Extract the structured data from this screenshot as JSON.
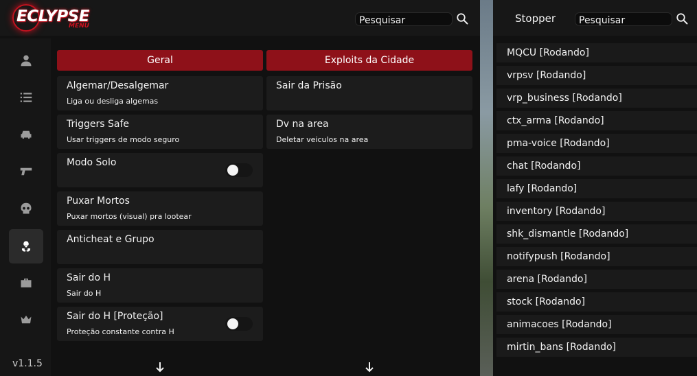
{
  "logo": {
    "main": "ECLYPSE",
    "sub": "MENU"
  },
  "search": {
    "placeholder": "Pesquisar"
  },
  "sidebar": {
    "items": [
      {
        "icon": "user-icon"
      },
      {
        "icon": "list-icon"
      },
      {
        "icon": "car-icon"
      },
      {
        "icon": "gun-icon"
      },
      {
        "icon": "skull-icon"
      },
      {
        "icon": "biohazard-icon",
        "active": true
      },
      {
        "icon": "toolbox-icon"
      },
      {
        "icon": "crown-icon"
      }
    ],
    "version": "v1.1.5"
  },
  "columns": {
    "left": {
      "header": "Geral",
      "cards": [
        {
          "title": "Algemar/Desalgemar",
          "desc": "Liga ou desliga algemas"
        },
        {
          "title": "Triggers Safe",
          "desc": "Usar triggers de modo seguro"
        },
        {
          "title": "Modo Solo",
          "desc": "",
          "toggle": false
        },
        {
          "title": "Puxar Mortos",
          "desc": "Puxar mortos (visual) pra lootear"
        },
        {
          "title": "Anticheat e Grupo",
          "desc": ""
        },
        {
          "title": "Sair do H",
          "desc": "Sair do H"
        },
        {
          "title": "Sair do H [Proteção]",
          "desc": "Proteção constante contra H",
          "toggle": false
        }
      ]
    },
    "right": {
      "header": "Exploits da Cidade",
      "cards": [
        {
          "title": "Sair da Prisão",
          "desc": ""
        },
        {
          "title": "Dv na area",
          "desc": "Deletar veiculos na area"
        }
      ]
    }
  },
  "resource_panel": {
    "title": "Stopper",
    "search_placeholder": "Pesquisar",
    "resources": [
      "MQCU [Rodando]",
      "vrpsv [Rodando]",
      "vrp_business [Rodando]",
      "ctx_arma [Rodando]",
      "pma-voice [Rodando]",
      "chat [Rodando]",
      "lafy [Rodando]",
      "inventory [Rodando]",
      "shk_dismantle [Rodando]",
      "notifypush [Rodando]",
      "arena [Rodando]",
      "stock [Rodando]",
      "animacoes [Rodando]",
      "mirtin_bans [Rodando]"
    ]
  },
  "colors": {
    "accent": "#8e1119",
    "panel": "#111111",
    "card": "#1c1c1c"
  }
}
